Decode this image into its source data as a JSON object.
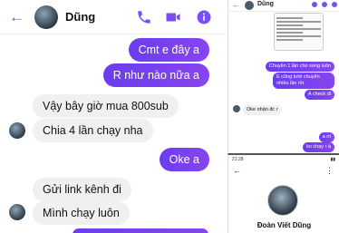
{
  "main_chat": {
    "contact_name": "Dũng",
    "icons": {
      "back": "back-arrow-icon",
      "call": "phone-icon",
      "video": "video-camera-icon",
      "info": "info-icon"
    },
    "accent_color": "#7b3ff2",
    "messages": [
      {
        "from": "me",
        "text": "Cmt e đây a"
      },
      {
        "from": "me",
        "text": "R như nào nữa a"
      },
      {
        "from": "them",
        "text": "Vậy bây giờ mua 800sub"
      },
      {
        "from": "them",
        "text": "Chia 4 lần chạy nha"
      },
      {
        "from": "me",
        "text": "Oke a"
      },
      {
        "from": "them",
        "text": "Gửi link kênh đi"
      },
      {
        "from": "them",
        "text": "Mình chạy luôn"
      }
    ]
  },
  "side_chat": {
    "contact_name": "Dũng",
    "messages": [
      {
        "from": "me",
        "text": "Chuyển 1 lần cho xong luôn"
      },
      {
        "from": "me",
        "text": "E cũng lười chuyển nhiều lần rồi"
      },
      {
        "from": "me",
        "text": "A check đi"
      },
      {
        "from": "them",
        "text": "Oke nhận đc r"
      },
      {
        "from": "me",
        "text": "a ơi"
      },
      {
        "from": "me",
        "text": "ko chạy r à"
      }
    ]
  },
  "profile": {
    "status_time": "21:28",
    "name": "Đoàn Viết Dũng",
    "icons": {
      "back": "back-arrow-icon",
      "menu": "more-vertical-icon"
    }
  }
}
